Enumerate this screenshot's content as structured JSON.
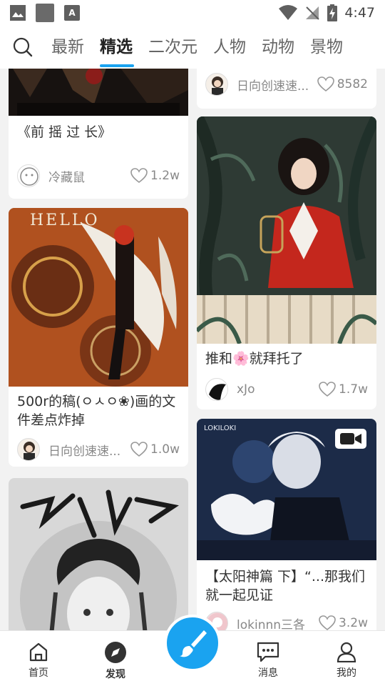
{
  "status_bar": {
    "time": "4:47",
    "left_icons": [
      "image-icon",
      "square-icon",
      "a-icon"
    ],
    "right_icons": [
      "wifi-icon",
      "no-signal-icon",
      "battery-charging-icon"
    ]
  },
  "tabs": {
    "search_icon": "search-icon",
    "items": [
      "最新",
      "精选",
      "二次元",
      "人物",
      "动物",
      "景物"
    ],
    "active": "精选",
    "accent": "#1aa3f0"
  },
  "feed": {
    "left": [
      {
        "title": "《前 摇 过 长》",
        "author": "冷藏鼠",
        "likes": "1.2w"
      },
      {
        "title": "500r的稿(ㅇㅅㅇ❀)画的文件差点炸掉",
        "author": "日向创速速...",
        "likes": "1.0w"
      },
      {
        "title": "",
        "author": "",
        "likes": ""
      }
    ],
    "right": [
      {
        "title": "",
        "author": "日向创速速...",
        "likes": "8582"
      },
      {
        "title": "推和🌸就拜托了",
        "author": "xJo",
        "likes": "1.7w"
      },
      {
        "title": "【太阳神篇 下】“...那我们就一起见证",
        "author": "lokinnn三各",
        "likes": "3.2w",
        "is_video": true
      }
    ]
  },
  "bottom_nav": {
    "items": [
      {
        "label": "首页",
        "icon": "home-icon"
      },
      {
        "label": "发现",
        "icon": "compass-icon"
      },
      {
        "label": "消息",
        "icon": "message-icon"
      },
      {
        "label": "我的",
        "icon": "profile-icon"
      }
    ],
    "fab_icon": "brush-icon"
  }
}
